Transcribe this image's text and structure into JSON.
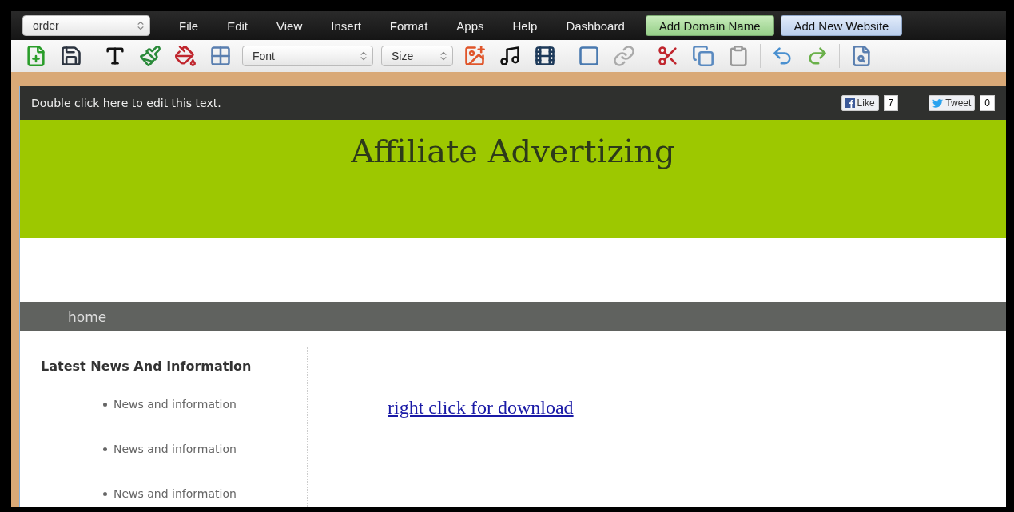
{
  "page_select": {
    "value": "order"
  },
  "menu": [
    "File",
    "Edit",
    "View",
    "Insert",
    "Format",
    "Apps",
    "Help",
    "Dashboard"
  ],
  "action_buttons": [
    {
      "label": "Add Domain Name",
      "kind": "green"
    },
    {
      "label": "Add New Website",
      "kind": "blue"
    }
  ],
  "toolbar": {
    "font_select": {
      "value": "Font"
    },
    "size_select": {
      "value": "Size"
    }
  },
  "site": {
    "top_bar": {
      "text": "Double click here to edit this text.",
      "like": {
        "label": "Like",
        "count": "7"
      },
      "tweet": {
        "label": "Tweet",
        "count": "0"
      }
    },
    "title": "Affiliate Advertizing",
    "nav": [
      "home"
    ],
    "sidebar": {
      "heading": "Latest News And Information",
      "items": [
        "News and information",
        "News and information",
        "News and information"
      ]
    },
    "link": "right click for download"
  }
}
